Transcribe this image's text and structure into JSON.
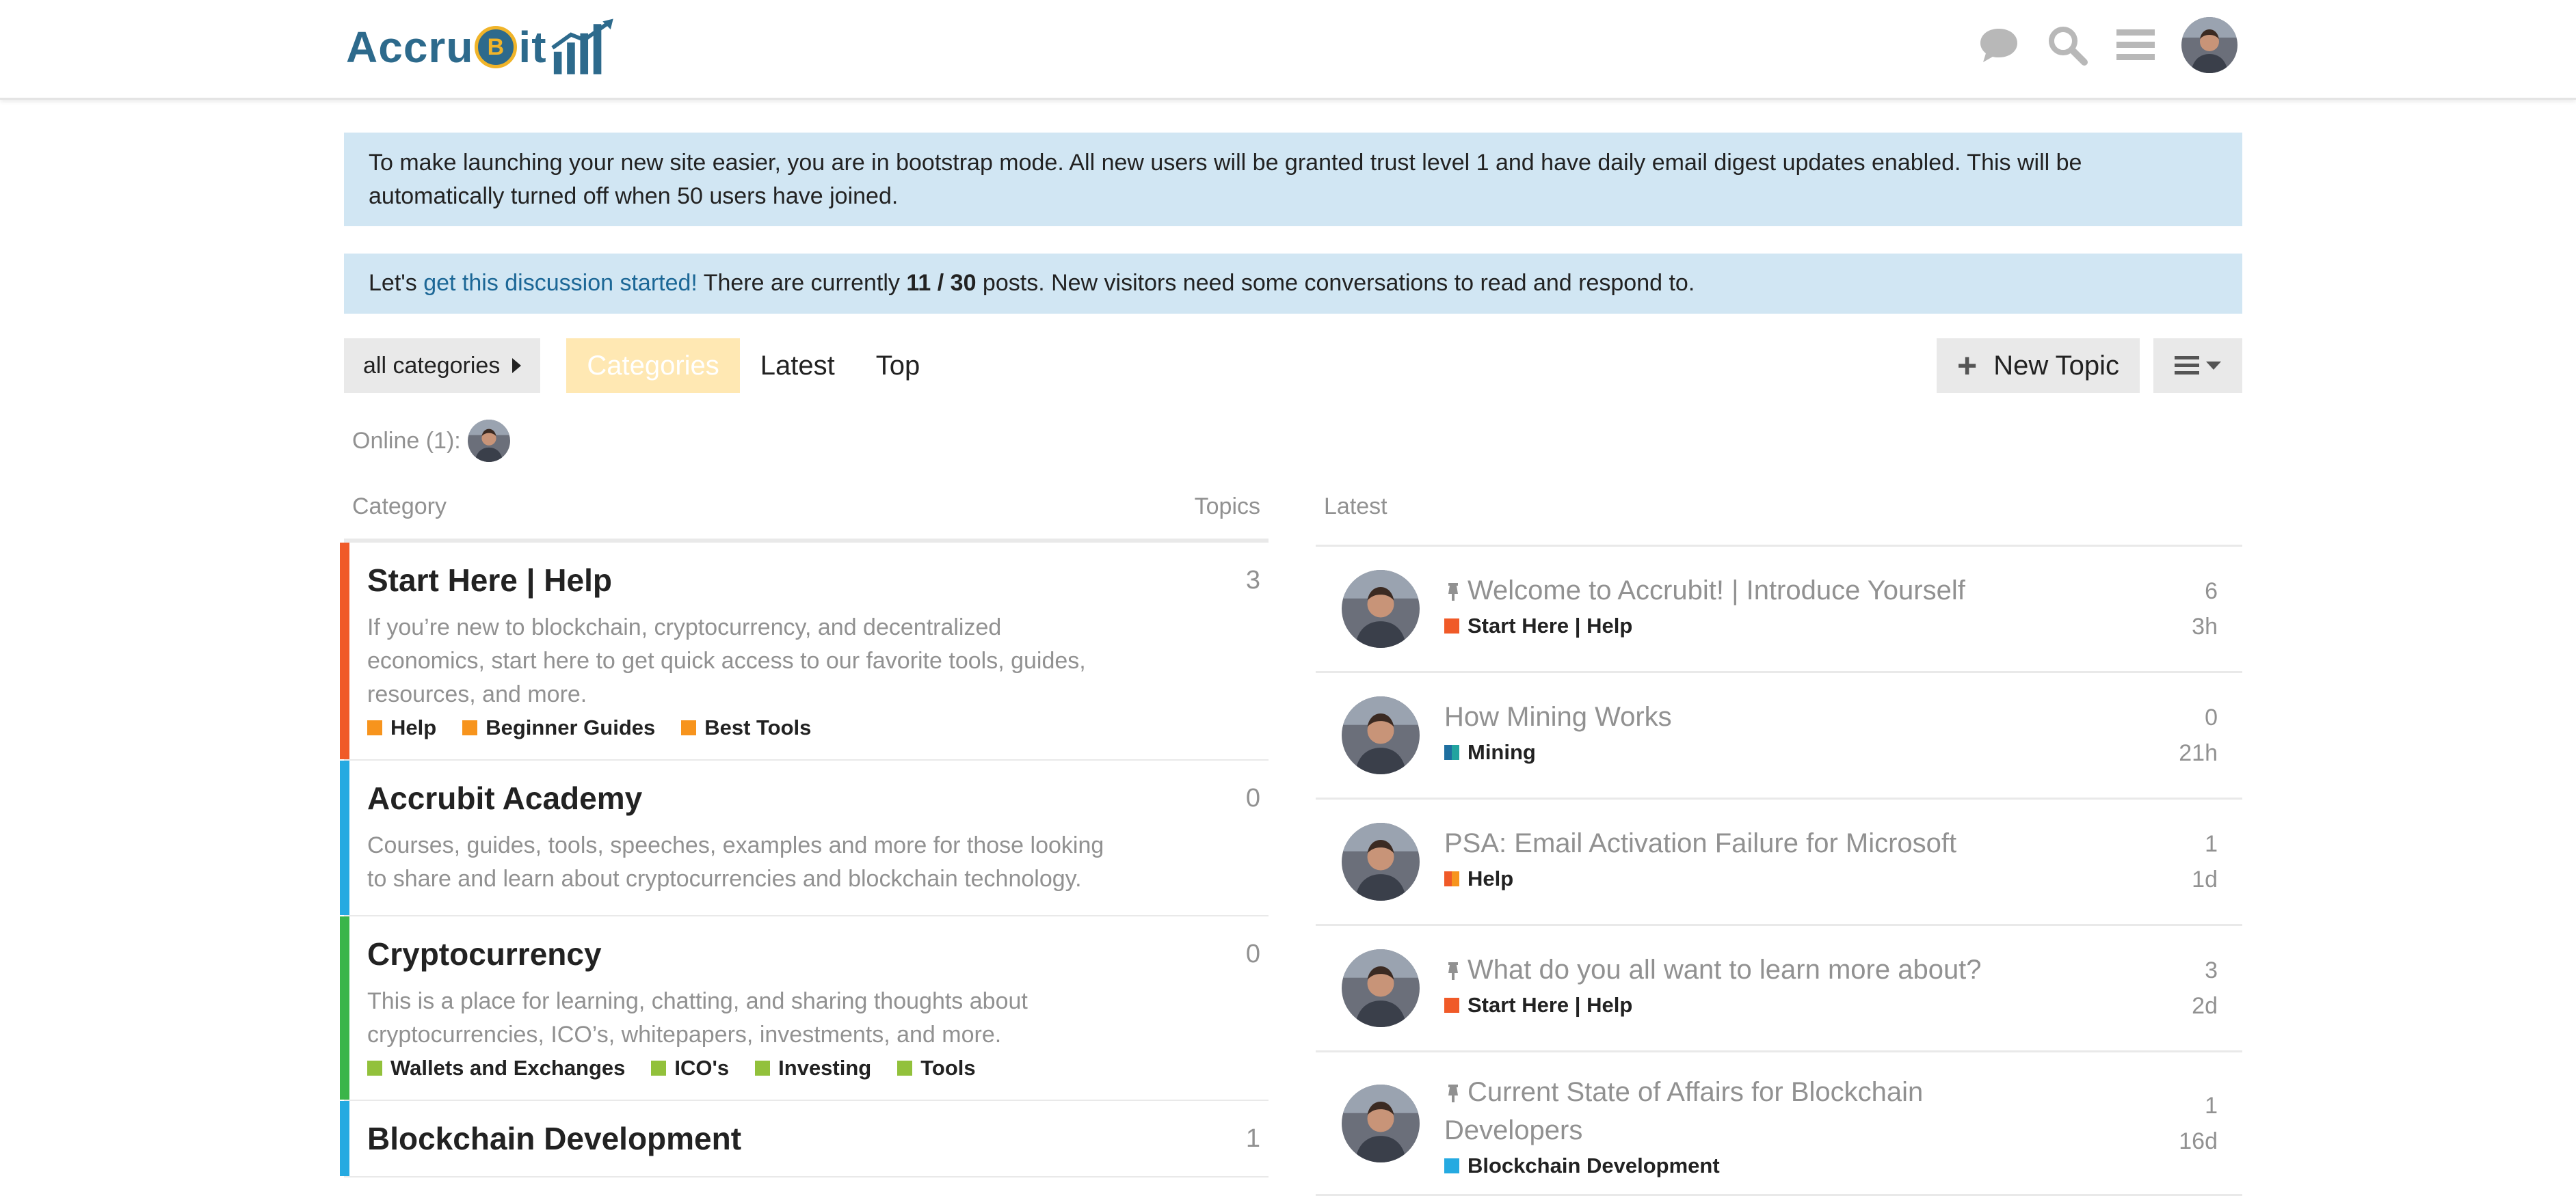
{
  "header": {
    "logo_text_left": "Accru",
    "logo_coin": "B",
    "logo_text_right": "it"
  },
  "notices": {
    "bootstrap": "To make launching your new site easier, you are in bootstrap mode. All new users will be granted trust level 1 and have daily email digest updates enabled. This will be automatically turned off when 50 users have joined.",
    "discussion_prefix": "Let's ",
    "discussion_link": "get this discussion started!",
    "discussion_middle": " There are currently ",
    "discussion_count": "11 / 30",
    "discussion_suffix": " posts. New visitors need some conversations to read and respond to."
  },
  "nav": {
    "category_dropdown": "all categories",
    "tabs": [
      "Categories",
      "Latest",
      "Top"
    ],
    "new_topic": "New Topic"
  },
  "online": {
    "label": "Online (1):"
  },
  "categories": {
    "header_category": "Category",
    "header_topics": "Topics",
    "items": [
      {
        "title": "Start Here | Help",
        "count": "3",
        "color": "#f05a28",
        "description": "If you’re new to blockchain, cryptocurrency, and decentralized economics, start here to get quick access to our favorite tools, guides, resources, and more.",
        "subcategories": [
          {
            "name": "Help",
            "color": "#f7941d"
          },
          {
            "name": "Beginner Guides",
            "color": "#f7941d"
          },
          {
            "name": "Best Tools",
            "color": "#f7941d"
          }
        ]
      },
      {
        "title": "Accrubit Academy",
        "count": "0",
        "color": "#25aae1",
        "description": "Courses, guides, tools, speeches, examples and more for those looking to share and learn about cryptocurrencies and blockchain technology.",
        "subcategories": []
      },
      {
        "title": "Cryptocurrency",
        "count": "0",
        "color": "#3ab54a",
        "description": "This is a place for learning, chatting, and sharing thoughts about cryptocurrencies, ICO’s, whitepapers, investments, and more.",
        "subcategories": [
          {
            "name": "Wallets and Exchanges",
            "color": "#92c13b"
          },
          {
            "name": "ICO's",
            "color": "#92c13b"
          },
          {
            "name": "Investing",
            "color": "#92c13b"
          },
          {
            "name": "Tools",
            "color": "#92c13b"
          }
        ]
      },
      {
        "title": "Blockchain Development",
        "count": "1",
        "color": "#25aae1",
        "description": "",
        "subcategories": []
      }
    ]
  },
  "latest": {
    "header": "Latest",
    "items": [
      {
        "title": "Welcome to Accrubit! | Introduce Yourself",
        "pinned": true,
        "category": "Start Here | Help",
        "category_color": "#f05a28",
        "replies": "6",
        "age": "3h"
      },
      {
        "title": "How Mining Works",
        "pinned": false,
        "category": "Mining",
        "category_color": "#1e6fa0",
        "category_color2": "#22a39f",
        "replies": "0",
        "age": "21h"
      },
      {
        "title": "PSA: Email Activation Failure for Microsoft",
        "pinned": false,
        "category": "Help",
        "category_color": "#f05a28",
        "category_color2": "#f7941d",
        "replies": "1",
        "age": "1d"
      },
      {
        "title": "What do you all want to learn more about?",
        "pinned": true,
        "category": "Start Here | Help",
        "category_color": "#f05a28",
        "replies": "3",
        "age": "2d"
      },
      {
        "title": "Current State of Affairs for Blockchain Developers",
        "pinned": true,
        "category": "Blockchain Development",
        "category_color": "#25aae1",
        "replies": "1",
        "age": "16d"
      }
    ]
  }
}
